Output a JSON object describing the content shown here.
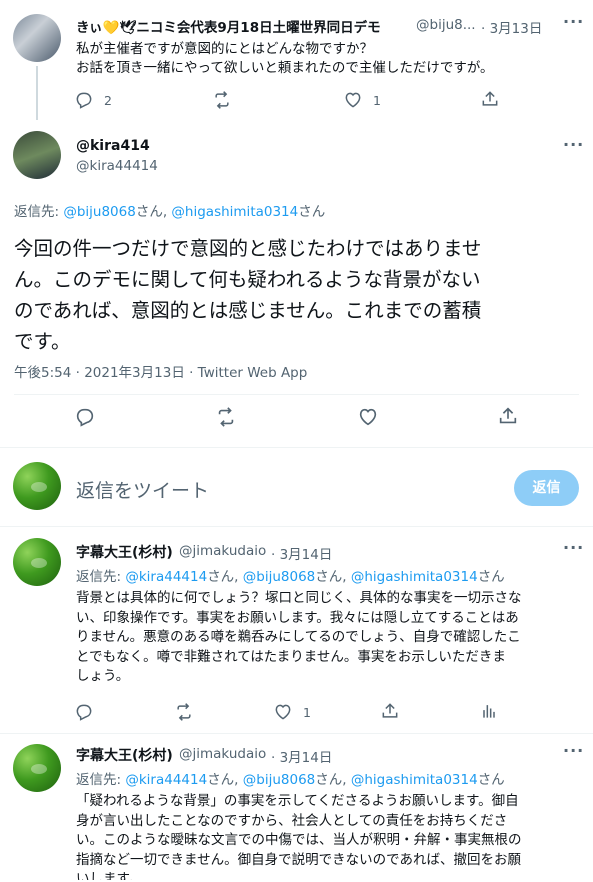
{
  "tweet1": {
    "name": "きぃ💛🕊ニコミ会代表9月18日土曜世界同日デモ",
    "handle": "@biju8...",
    "date": "· 3月13日",
    "line1": "私が主催者ですが意図的にとはどんな物ですか？",
    "line2": "お話を頂き一緒にやって欲しいと頼まれたので主催しただけですが。",
    "reply_count": "2",
    "like_count": "1"
  },
  "main_tweet": {
    "name": "@kira414",
    "handle": "@kira44414",
    "reply_to_prefix": "返信先: ",
    "reply_to_user1": "@biju8068",
    "reply_to_san1": "さん, ",
    "reply_to_user2": "@higashimita0314",
    "reply_to_san2": "さん",
    "line1": "今回の件一つだけで意図的と感じたわけではありませ",
    "line2": "ん。このデモに関して何も疑われるような背景がない",
    "line3": "のであれば、意図的とは感じません。これまでの蓄積",
    "line4": "です。",
    "meta": "午後5:54 · 2021年3月13日 · Twitter Web App"
  },
  "composer": {
    "placeholder": "返信をツイート",
    "reply_button": "返信"
  },
  "reply1": {
    "name": "字幕大王(杉村)",
    "handle": "@jimakudaio",
    "date": "· 3月14日",
    "reply_to_prefix": "返信先: ",
    "reply_to_user1": "@kira44414",
    "sep1": "さん, ",
    "reply_to_user2": "@biju8068",
    "sep2": "さん, ",
    "reply_to_user3": "@higashimita0314",
    "sep3": "さん",
    "line1": "背景とは具体的に何でしょう？塚口と同じく、具体的な事実を一切示さな",
    "line2": "い、印象操作です。事実をお願いします。我々には隠し立てすることはあ",
    "line3": "りません。悪意のある噂を鵜呑みにしてるのでしょう、自身で確認したこ",
    "line4": "とでもなく。噂で非難されてはたまりません。事実をお示しいただきま",
    "line5": "しょう。",
    "like_count": "1"
  },
  "reply2": {
    "name": "字幕大王(杉村)",
    "handle": "@jimakudaio",
    "date": "· 3月14日",
    "reply_to_prefix": "返信先: ",
    "reply_to_user1": "@kira44414",
    "sep1": "さん, ",
    "reply_to_user2": "@biju8068",
    "sep2": "さん, ",
    "reply_to_user3": "@higashimita0314",
    "sep3": "さん",
    "line1": "「疑われるような背景」の事実を示してくださるようお願いします。御自",
    "line2": "身が言い出したことなのですから、社会人としての責任をお持ちくださ",
    "line3": "い。このような曖昧な文言での中傷では、当人が釈明・弁解・事実無根の",
    "line4": "指摘など一切できません。御自身で説明できないのであれば、撤回をお願",
    "line5": "いします。"
  },
  "colors": {
    "accent": "#1d9bf0",
    "grey": "#536471",
    "text": "#0f1419",
    "button_disabled": "#8ecdf7"
  },
  "icons": [
    "reply-icon",
    "retweet-icon",
    "like-icon",
    "share-icon",
    "more-icon",
    "analytics-icon"
  ]
}
